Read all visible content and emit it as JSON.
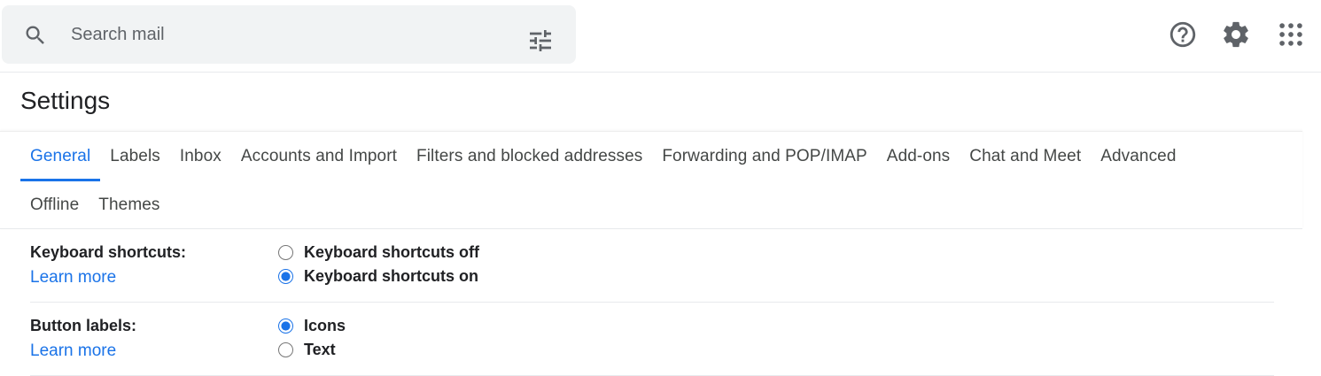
{
  "search": {
    "placeholder": "Search mail"
  },
  "icons": {
    "search": "search-icon",
    "tune": "tune-icon",
    "help": "help-icon",
    "settings": "gear-icon",
    "apps": "apps-icon"
  },
  "page": {
    "title": "Settings"
  },
  "tabs": [
    {
      "label": "General",
      "active": true
    },
    {
      "label": "Labels"
    },
    {
      "label": "Inbox"
    },
    {
      "label": "Accounts and Import"
    },
    {
      "label": "Filters and blocked addresses"
    },
    {
      "label": "Forwarding and POP/IMAP"
    },
    {
      "label": "Add-ons"
    },
    {
      "label": "Chat and Meet"
    },
    {
      "label": "Advanced"
    },
    {
      "label": "Offline"
    },
    {
      "label": "Themes"
    }
  ],
  "sections": [
    {
      "label": "Keyboard shortcuts:",
      "learn_more": "Learn more",
      "options": [
        {
          "label": "Keyboard shortcuts off",
          "selected": false
        },
        {
          "label": "Keyboard shortcuts on",
          "selected": true
        }
      ]
    },
    {
      "label": "Button labels:",
      "learn_more": "Learn more",
      "options": [
        {
          "label": "Icons",
          "selected": true
        },
        {
          "label": "Text",
          "selected": false
        }
      ]
    }
  ],
  "colors": {
    "accent": "#1a73e8",
    "search_bg": "#f1f3f4",
    "icon": "#5f6368"
  }
}
